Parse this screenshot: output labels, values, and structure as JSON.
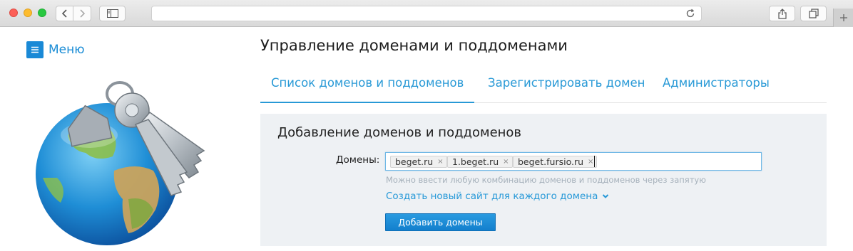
{
  "browser": {
    "url": "",
    "icons": [
      "back-icon",
      "forward-icon",
      "sidebar-icon",
      "reload-icon",
      "share-icon",
      "tabs-icon",
      "plus-icon"
    ]
  },
  "sidebar": {
    "menu_label": "Меню"
  },
  "main": {
    "title": "Управление доменами и поддоменами",
    "tabs": [
      {
        "label": "Список доменов и поддоменов",
        "active": true
      },
      {
        "label": "Зарегистрировать домен",
        "active": false
      },
      {
        "label": "Администраторы",
        "active": false
      }
    ],
    "panel": {
      "title": "Добавление доменов и поддоменов",
      "field_label": "Домены:",
      "tags": [
        "beget.ru",
        "1.beget.ru",
        "beget.fursio.ru"
      ],
      "remove_symbol": "×",
      "hint": "Можно ввести любую комбинацию доменов и поддоменов через запятую",
      "create_site_link": "Создать новый сайт для каждого домена",
      "add_button": "Добавить домены"
    }
  },
  "colors": {
    "accent": "#2899d6",
    "button": "#1a8ad6",
    "panel_bg": "#eef1f4"
  }
}
